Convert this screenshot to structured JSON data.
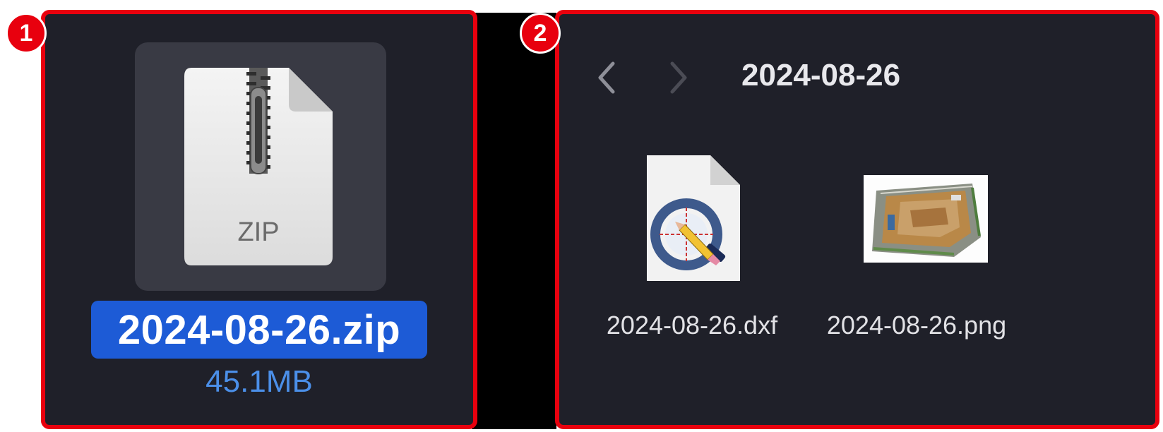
{
  "markers": {
    "one": "1",
    "two": "2"
  },
  "archive": {
    "icon_label": "ZIP",
    "filename": "2024-08-26.zip",
    "size": "45.1MB"
  },
  "finder": {
    "folder_title": "2024-08-26",
    "files": [
      {
        "name": "2024-08-26.dxf",
        "icon": "dxf-document-icon"
      },
      {
        "name": "2024-08-26.png",
        "icon": "aerial-image-thumbnail"
      }
    ]
  },
  "colors": {
    "highlight_border": "#e8000e",
    "panel_bg": "#1f2029",
    "selection_blue": "#1d5bd6",
    "size_text": "#4b8fe8"
  }
}
